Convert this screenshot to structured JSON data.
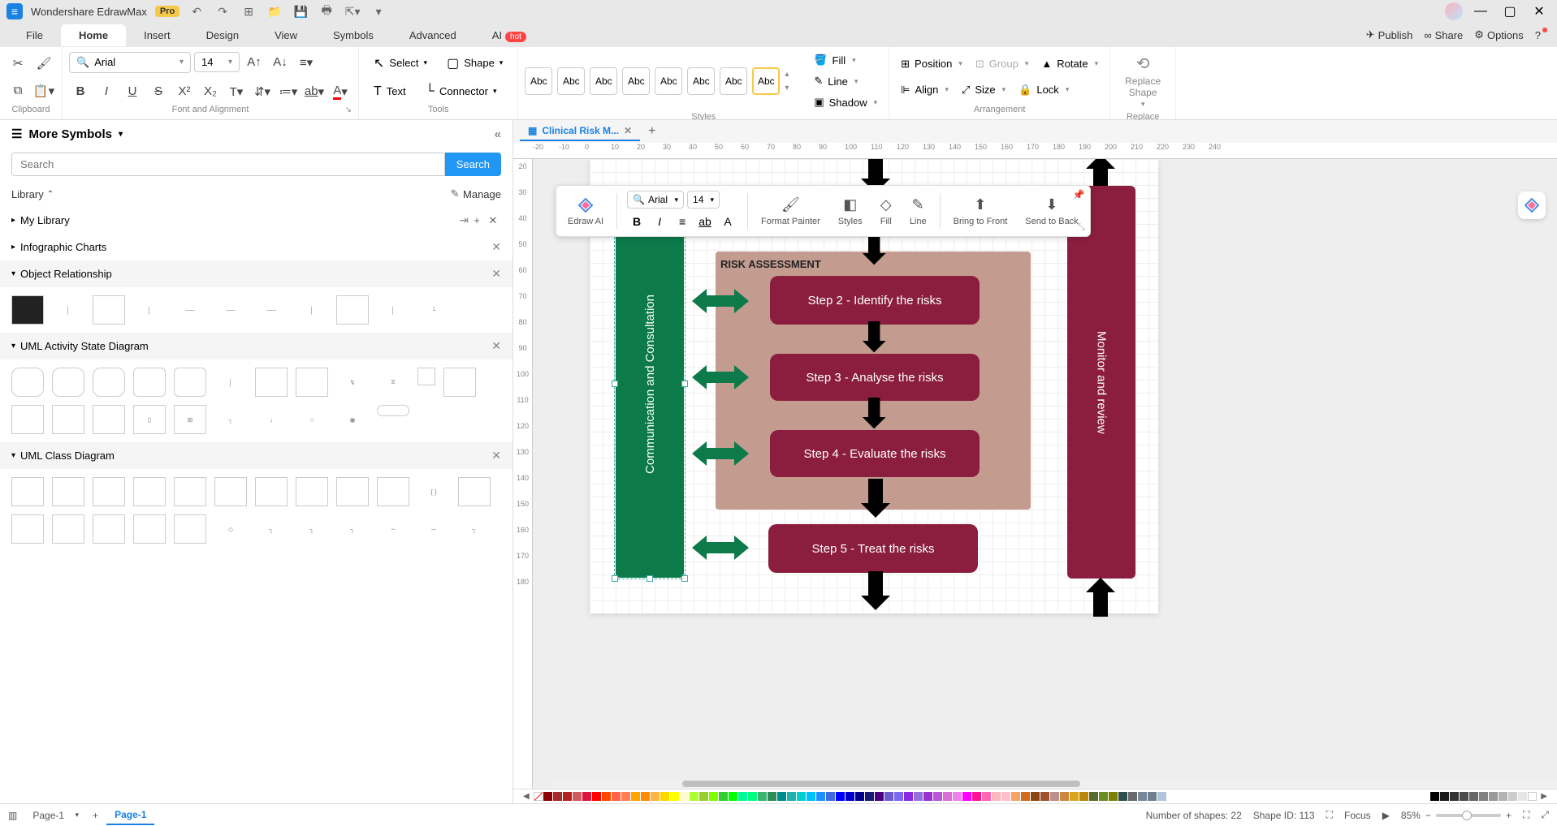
{
  "app": {
    "title": "Wondershare EdrawMax",
    "pro": "Pro"
  },
  "menus": [
    "File",
    "Home",
    "Insert",
    "Design",
    "View",
    "Symbols",
    "Advanced",
    "AI"
  ],
  "menu_active": 1,
  "ai_badge": "hot",
  "topright": {
    "publish": "Publish",
    "share": "Share",
    "options": "Options"
  },
  "ribbon": {
    "clipboard": "Clipboard",
    "font_align": "Font and Alignment",
    "font": "Arial",
    "size": "14",
    "tools": "Tools",
    "select": "Select",
    "shape": "Shape",
    "text": "Text",
    "connector": "Connector",
    "styles": "Styles",
    "style_label": "Abc",
    "fill": "Fill",
    "line": "Line",
    "shadow": "Shadow",
    "arrangement": "Arrangement",
    "position": "Position",
    "align": "Align",
    "group": "Group",
    "size_lbl": "Size",
    "rotate": "Rotate",
    "lock": "Lock",
    "replace": "Replace",
    "replace_shape": "Replace\nShape"
  },
  "left": {
    "more_symbols": "More Symbols",
    "search_ph": "Search",
    "search_btn": "Search",
    "library": "Library",
    "manage": "Manage",
    "my_library": "My Library",
    "sections": [
      "Infographic Charts",
      "Object Relationship",
      "UML Activity State Diagram",
      "UML Class Diagram"
    ]
  },
  "doc": {
    "tab": "Clinical Risk M..."
  },
  "ruler_h": [
    "-20",
    "-10",
    "0",
    "10",
    "20",
    "30",
    "40",
    "50",
    "60",
    "70",
    "80",
    "90",
    "100",
    "110",
    "120",
    "130",
    "140",
    "150",
    "160",
    "170",
    "180",
    "190",
    "200",
    "210",
    "220",
    "230",
    "240"
  ],
  "ruler_v": [
    "20",
    "30",
    "40",
    "50",
    "60",
    "70",
    "80",
    "90",
    "100",
    "110",
    "120",
    "130",
    "140",
    "150",
    "160",
    "170",
    "180"
  ],
  "float": {
    "edraw_ai": "Edraw AI",
    "font": "Arial",
    "size": "14",
    "format_painter": "Format Painter",
    "styles": "Styles",
    "fill": "Fill",
    "line": "Line",
    "bring_front": "Bring to Front",
    "send_back": "Send to Back"
  },
  "diagram": {
    "comm": "Communication and Consultation",
    "monitor": "Monitor and review",
    "assess": "RISK ASSESSMENT",
    "step2": "Step 2 - Identify  the risks",
    "step3": "Step 3 - Analyse the risks",
    "step4": "Step 4 - Evaluate the risks",
    "step5": "Step 5 - Treat the risks"
  },
  "status": {
    "page_sel": "Page-1",
    "page_tab": "Page-1",
    "shapes": "Number of shapes: 22",
    "shape_id": "Shape ID: 113",
    "focus": "Focus",
    "zoom": "85%"
  }
}
